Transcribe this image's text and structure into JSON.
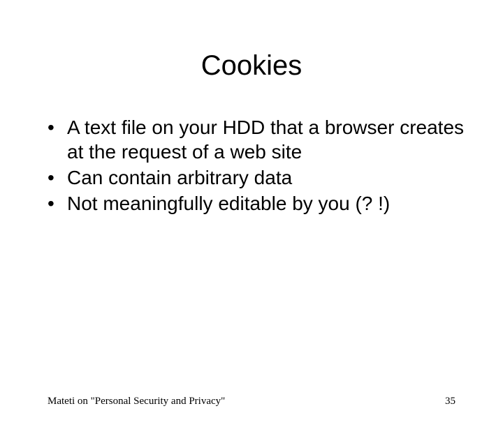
{
  "slide": {
    "title": "Cookies",
    "bullets": [
      "A text file on your HDD that a browser creates at the request of a web site",
      "Can contain arbitrary data",
      "Not meaningfully editable by you (? !)"
    ],
    "footer": {
      "left": "Mateti on \"Personal Security and Privacy\"",
      "page_number": "35"
    }
  }
}
